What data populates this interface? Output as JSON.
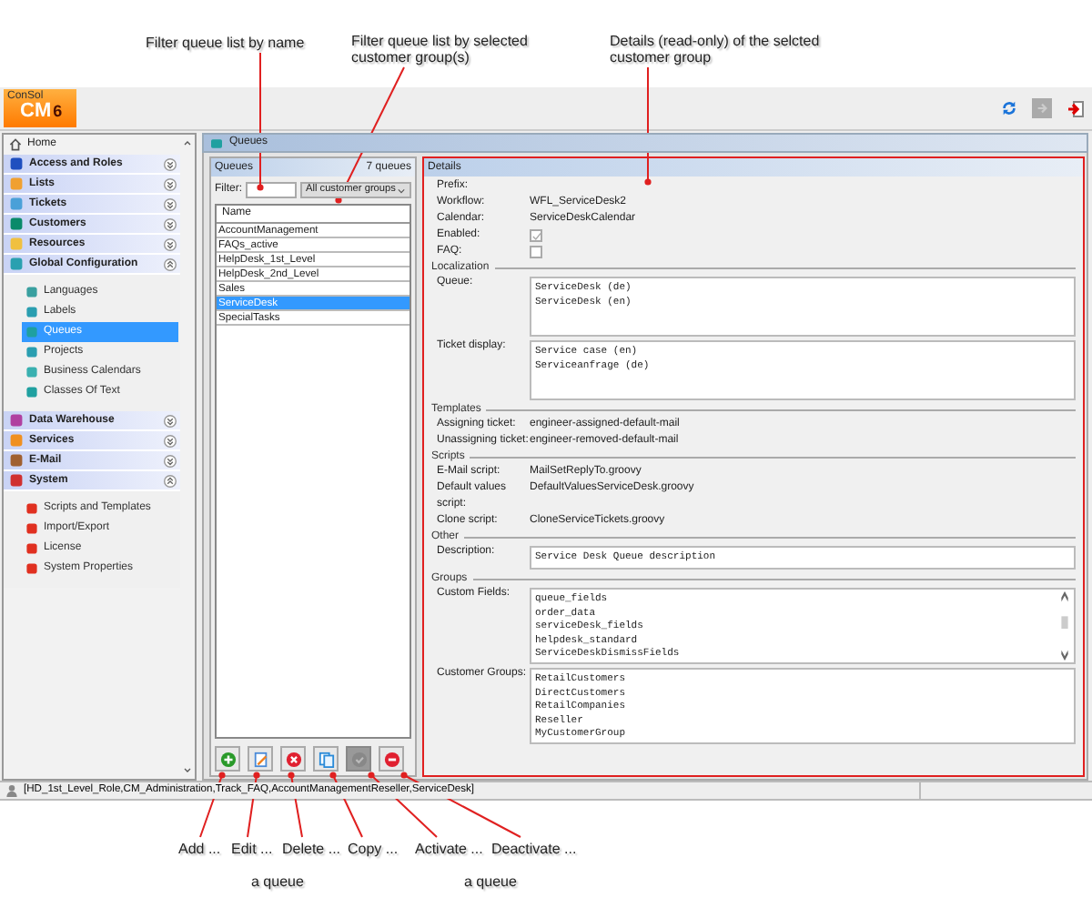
{
  "annotations_top": [
    {
      "text": "Filter queue list by name"
    },
    {
      "text": "Filter queue list by selected customer group(s)"
    },
    {
      "text": "Details (read-only) of the selcted customer group"
    }
  ],
  "logo": {
    "brand": "ConSol",
    "product": "CM",
    "version": "6"
  },
  "sidebar": {
    "home": "Home",
    "sections": [
      {
        "label": "Access and Roles",
        "expanded": false
      },
      {
        "label": "Lists",
        "expanded": false
      },
      {
        "label": "Tickets",
        "expanded": false
      },
      {
        "label": "Customers",
        "expanded": false
      },
      {
        "label": "Resources",
        "expanded": false
      },
      {
        "label": "Global Configuration",
        "expanded": true,
        "items": [
          {
            "label": "Languages",
            "selected": false
          },
          {
            "label": "Labels",
            "selected": false
          },
          {
            "label": "Queues",
            "selected": true
          },
          {
            "label": "Projects",
            "selected": false
          },
          {
            "label": "Business Calendars",
            "selected": false
          },
          {
            "label": "Classes Of Text",
            "selected": false
          }
        ]
      },
      {
        "label": "Data Warehouse",
        "expanded": false
      },
      {
        "label": "Services",
        "expanded": false
      },
      {
        "label": "E-Mail",
        "expanded": false
      },
      {
        "label": "System",
        "expanded": true,
        "items": [
          {
            "label": "Scripts and Templates",
            "selected": false
          },
          {
            "label": "Import/Export",
            "selected": false
          },
          {
            "label": "License",
            "selected": false
          },
          {
            "label": "System Properties",
            "selected": false
          }
        ]
      }
    ]
  },
  "workspace_title": "Queues",
  "queues": {
    "title": "Queues",
    "count": "7 queues",
    "filter_label": "Filter:",
    "group_select": "All customer groups",
    "column": "Name",
    "rows": [
      {
        "name": "AccountManagement",
        "selected": false
      },
      {
        "name": "FAQs_active",
        "selected": false
      },
      {
        "name": "HelpDesk_1st_Level",
        "selected": false
      },
      {
        "name": "HelpDesk_2nd_Level",
        "selected": false
      },
      {
        "name": "Sales",
        "selected": false
      },
      {
        "name": "ServiceDesk",
        "selected": true
      },
      {
        "name": "SpecialTasks",
        "selected": false
      }
    ]
  },
  "toolbar": [
    {
      "kind": "add",
      "disabled": false
    },
    {
      "kind": "edit",
      "disabled": false
    },
    {
      "kind": "delete",
      "disabled": false
    },
    {
      "kind": "copy",
      "disabled": false
    },
    {
      "kind": "activate",
      "disabled": true
    },
    {
      "kind": "deactivate",
      "disabled": false
    }
  ],
  "details": {
    "title": "Details",
    "sections": [
      {
        "rows": [
          {
            "label": "Prefix:",
            "kind": "text"
          },
          {
            "label": "Workflow:",
            "kind": "text",
            "value": "WFL_ServiceDesk2"
          },
          {
            "label": "Calendar:",
            "kind": "text",
            "value": "ServiceDeskCalendar"
          },
          {
            "label": "Enabled:",
            "kind": "checkbox",
            "checked": true
          },
          {
            "label": "FAQ:",
            "kind": "checkbox",
            "checked": false
          }
        ]
      },
      {
        "heading": "Localization",
        "rows": [
          {
            "label": "Queue:",
            "kind": "box",
            "lines": [
              "ServiceDesk (de)",
              "ServiceDesk (en)"
            ]
          },
          {
            "label": "Ticket display:",
            "kind": "box",
            "lines": [
              "Service case (en)",
              "Serviceanfrage (de)"
            ]
          }
        ]
      },
      {
        "heading": "Templates",
        "rows": [
          {
            "label": "Assigning ticket:",
            "kind": "text",
            "value": "engineer-assigned-default-mail"
          },
          {
            "label": "Unassigning ticket:",
            "kind": "text",
            "value": "engineer-removed-default-mail"
          }
        ]
      },
      {
        "heading": "Scripts",
        "rows": [
          {
            "label": "E-Mail script:",
            "kind": "text",
            "value": "MailSetReplyTo.groovy"
          },
          {
            "label": "Default values script:",
            "kind": "text",
            "value": "DefaultValuesServiceDesk.groovy"
          },
          {
            "label": "Clone script:",
            "kind": "text",
            "value": "CloneServiceTickets.groovy"
          }
        ]
      },
      {
        "heading": "Other",
        "rows": [
          {
            "label": "Description:",
            "kind": "box",
            "lines": [
              "Service Desk Queue description"
            ]
          }
        ]
      },
      {
        "heading": "Groups",
        "rows": [
          {
            "label": "Custom Fields:",
            "kind": "scroll_box",
            "lines": [
              "queue_fields",
              "order_data",
              "serviceDesk_fields",
              "helpdesk_standard",
              "ServiceDeskDismissFields"
            ]
          },
          {
            "label": "Customer Groups:",
            "kind": "box",
            "lines": [
              "RetailCustomers",
              "DirectCustomers",
              "RetailCompanies",
              "Reseller",
              "MyCustomerGroup"
            ]
          }
        ]
      }
    ]
  },
  "status_bar": "[HD_1st_Level_Role,CM_Administration,Track_FAQ,AccountManagementReseller,ServiceDesk]",
  "annotations_bottom": [
    {
      "text": "Add ..."
    },
    {
      "text": "Edit ..."
    },
    {
      "text": "Delete ..."
    },
    {
      "text": "Copy ..."
    },
    {
      "text": "Activate ..."
    },
    {
      "text": "Deactivate ..."
    }
  ],
  "annotation_notes": [
    "a queue",
    "a queue"
  ]
}
